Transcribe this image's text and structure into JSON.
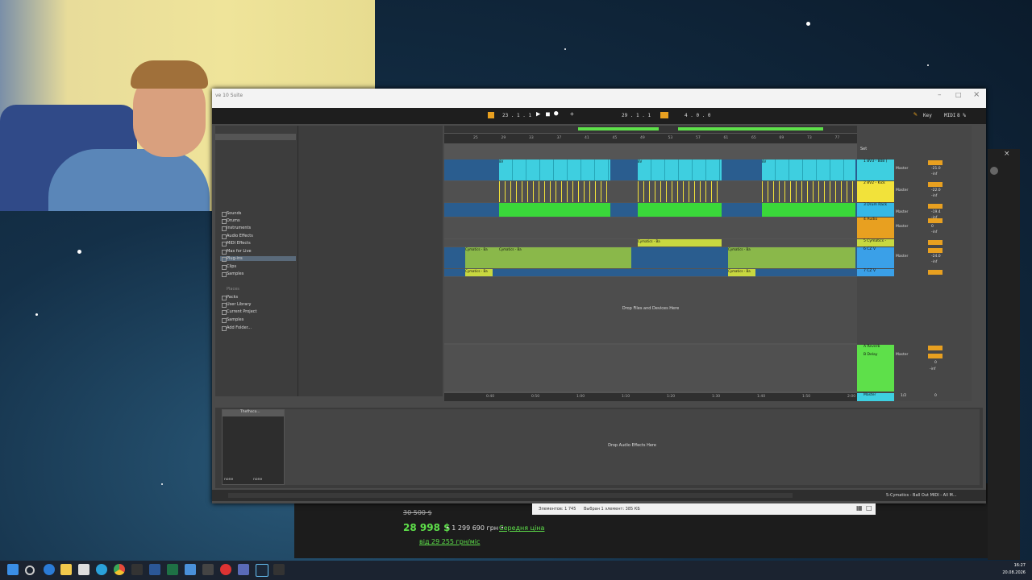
{
  "app": {
    "title": "ve 10 Suite",
    "key_label": "Key",
    "midi_label": "MIDI",
    "cpu": "8 %"
  },
  "transport": {
    "position": "23 .  1 .  1",
    "loop_start": "29 .  1 .  1",
    "loop_length": "4 .  0 .  0"
  },
  "ruler": {
    "bars": [
      "25",
      "29",
      "33",
      "37",
      "41",
      "45",
      "49",
      "53",
      "57",
      "61",
      "65",
      "69",
      "73",
      "77"
    ],
    "time_labels": [
      "0:40",
      "0:50",
      "1:00",
      "1:10",
      "1:20",
      "1:30",
      "1:40",
      "1:50",
      "2:00"
    ]
  },
  "browser": {
    "categories": [
      "Sounds",
      "Drums",
      "Instruments",
      "Audio Effects",
      "MIDI Effects",
      "Max for Live",
      "Plug-ins",
      "Clips",
      "Samples"
    ],
    "places_header": "Places",
    "places": [
      "Packs",
      "User Library",
      "Current Project",
      "Samples",
      "Add Folder..."
    ]
  },
  "arrangement": {
    "drop_hint": "Drop Files and Devices Here",
    "clip_name": "Cymatics - Ba",
    "midi_clip_prefix": "8V",
    "set_label": "Set"
  },
  "tracks": [
    {
      "name": "1 8V3 - 808 (",
      "color": "#3ecfe0",
      "volume": "-21.0",
      "peak": "-inf",
      "routing": "Master"
    },
    {
      "name": "2 8V2 - Kick",
      "color": "#f2e23a",
      "volume": "-22.0",
      "peak": "-inf",
      "routing": "Master"
    },
    {
      "name": "3 Drum Rack",
      "color": "#36b8e6",
      "volume": "-19.4",
      "peak": "-inf",
      "routing": "Master"
    },
    {
      "name": "4 Audio",
      "color": "#e8a020",
      "volume": "0",
      "peak": "-inf",
      "routing": "Master"
    },
    {
      "name": "5 Cymatics -",
      "color": "#c8d840",
      "volume": "",
      "peak": "",
      "routing": ""
    },
    {
      "name": "6 CZ V",
      "color": "#3aa0e8",
      "volume": "-24.0",
      "peak": "-inf",
      "routing": "Master"
    },
    {
      "name": "7 CZ V",
      "color": "#3aa0e8",
      "volume": "",
      "peak": "",
      "routing": ""
    }
  ],
  "returns": [
    {
      "name": "A Reverb",
      "color": "#5ee04a"
    },
    {
      "name": "B Delay",
      "color": "#5ee04a",
      "routing": "Master",
      "volume": "0",
      "peak": "-inf"
    }
  ],
  "master": {
    "name": "Master",
    "value": "1/2",
    "volume": "0"
  },
  "device_panel": {
    "drop_hint": "Drop Audio Effects Here",
    "clip_box_title": "Thefhsco...",
    "none_a": "none",
    "none_b": "none"
  },
  "status_right": "5-Cymatics - Ball Out MIDI - All M...",
  "explorer_status": {
    "items": "Элементов: 1 745",
    "selected": "Выбран 1 элемент: 385 КБ"
  },
  "shop": {
    "old_price": "30 500 $",
    "price": "28 998 $",
    "uah": "• 1 299 690 грн •",
    "avg_label": "Середня ціна",
    "monthly": "від 29 255 грн/міс"
  },
  "clock": {
    "time": "16:27",
    "date": "20.08.2026"
  },
  "colors": {
    "accent": "#e8a020",
    "teal": "#3ecfe0",
    "green": "#5ee04a",
    "blue": "#2a5d8f"
  }
}
